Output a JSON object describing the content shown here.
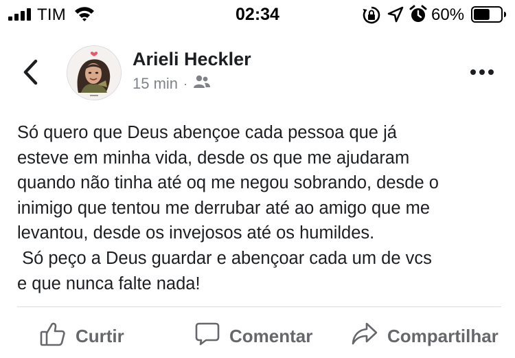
{
  "status_bar": {
    "carrier": "TIM",
    "time": "02:34",
    "battery_percent": "60%",
    "battery_level": 0.6,
    "icons": [
      "signal-icon",
      "wifi-icon",
      "rotation-lock-icon",
      "location-icon",
      "alarm-icon",
      "battery-icon"
    ]
  },
  "post": {
    "author": "Arieli Heckler",
    "time_ago": "15 min",
    "separator": "·",
    "audience_icon": "friends-icon",
    "text": "Só quero que Deus abençoe cada pessoa que já\nesteve em minha vida, desde os que me ajudaram\nquando não tinha até oq me negou sobrando, desde o\ninimigo que tentou me derrubar até ao amigo que me\nlevantou, desde os invejosos até os humildes.\n Só peço a Deus guardar e abençoar cada um de vcs\ne que nunca falte nada!"
  },
  "actions": {
    "like_label": "Curtir",
    "comment_label": "Comentar",
    "share_label": "Compartilhar"
  },
  "colors": {
    "text": "#1c1e21",
    "meta": "#7f8389",
    "action": "#65676b",
    "divider": "#dadde1"
  }
}
